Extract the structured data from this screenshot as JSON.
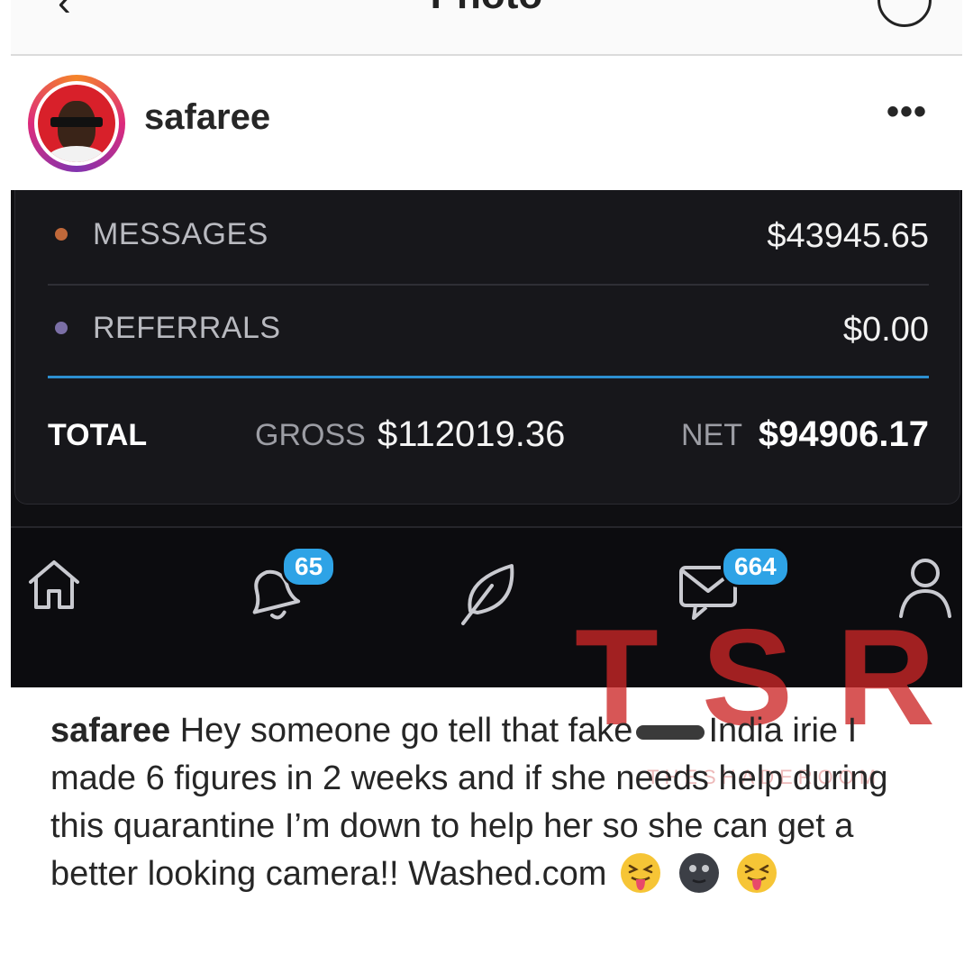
{
  "topbar": {
    "back_glyph": "‹",
    "title": "Photo"
  },
  "post": {
    "username": "safaree",
    "more_glyph": "•••"
  },
  "earnings": {
    "rows": [
      {
        "label": "MESSAGES",
        "value": "$43945.65",
        "dot_color": "#c0683a"
      },
      {
        "label": "REFERRALS",
        "value": "$0.00",
        "dot_color": "#7b6fa6"
      }
    ],
    "total_label": "TOTAL",
    "gross_label": "GROSS",
    "gross_value": "$112019.36",
    "net_label": "NET",
    "net_value": "$94906.17",
    "accent_color": "#2d8fd0"
  },
  "bottom_nav": {
    "items": [
      {
        "icon": "home-icon"
      },
      {
        "icon": "bell-icon",
        "badge": "65"
      },
      {
        "icon": "leaf-icon"
      },
      {
        "icon": "messages-icon",
        "badge": "664"
      },
      {
        "icon": "profile-icon"
      }
    ]
  },
  "watermark": {
    "logo": "TSR",
    "subtitle": "THESHADEROOM"
  },
  "caption": {
    "username": "safaree",
    "text_part1": "Hey someone go tell that fake",
    "text_part2": "India irie I made 6 figures in 2 weeks and if she needs help during this quarantine I’m down to help her so she can get a better looking camera!! Washed.com",
    "emojis": [
      "squinting-tongue-emoji",
      "new-moon-face-emoji",
      "squinting-tongue-emoji"
    ]
  }
}
